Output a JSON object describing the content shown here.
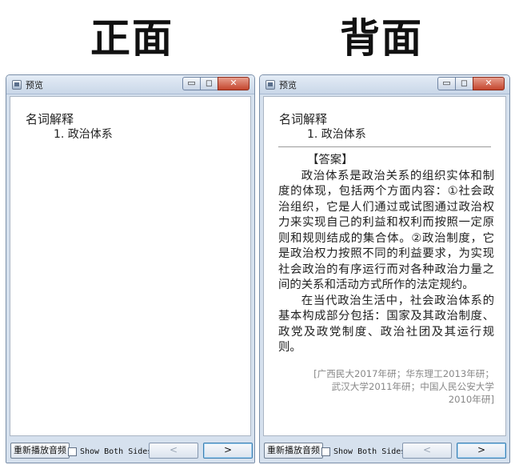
{
  "labels": {
    "front": "正面",
    "back": "背面"
  },
  "window": {
    "title": "预览",
    "min_glyph": "▭",
    "max_glyph": "◻",
    "close_glyph": "✕"
  },
  "front_card": {
    "heading": "名词解释",
    "item": "1. 政治体系"
  },
  "back_card": {
    "heading": "名词解释",
    "item": "1. 政治体系",
    "answer_label": "【答案】",
    "paragraph1": "政治体系是政治关系的组织实体和制度的体现，包括两个方面内容：①社会政治组织，它是人们通过或试图通过政治权力来实现自己的利益和权利而按照一定原则和规则结成的集合体。②政治制度，它是政治权力按照不同的利益要求，为实现社会政治的有序运行而对各种政治力量之间的关系和活动方式所作的法定规约。",
    "paragraph2": "在当代政治生活中，社会政治体系的基本构成部分包括：国家及其政治制度、政党及政党制度、政治社团及其运行规则。",
    "source": "[广西民大2017年研；华东理工2013年研；武汉大学2011年研；中国人民公安大学2010年研]"
  },
  "bottom": {
    "replay_label": "重新播放音频",
    "show_both_label": "Show Both Sides",
    "show_both_checked": false,
    "prev_glyph": "<",
    "next_glyph": ">"
  },
  "icons": {
    "app": "app-icon",
    "checkbox": "checkbox-icon"
  }
}
